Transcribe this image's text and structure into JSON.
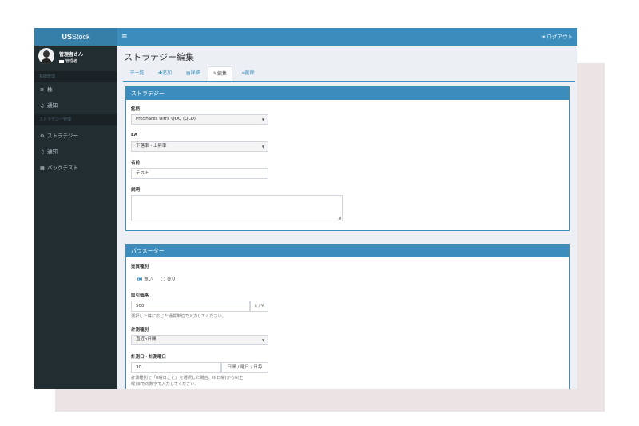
{
  "app": {
    "logo_bold": "US",
    "logo_rest": "Stock",
    "menu_icon": "≡",
    "logout_label": "ログアウト"
  },
  "user": {
    "name": "管理者さん",
    "role": "管理者"
  },
  "sidebar": {
    "section1": "株価管理",
    "section1_items": [
      {
        "label": "株",
        "icon": "database-icon"
      },
      {
        "label": "通知",
        "icon": "bell-icon"
      }
    ],
    "section2": "ストラテジー管理",
    "section2_items": [
      {
        "label": "ストラテジー",
        "icon": "cogs-icon"
      },
      {
        "label": "通知",
        "icon": "bell-icon"
      },
      {
        "label": "バックテスト",
        "icon": "calendar-icon"
      }
    ]
  },
  "page": {
    "title": "ストラテジー編集"
  },
  "tabs": [
    {
      "label": "一覧",
      "icon": "list-icon"
    },
    {
      "label": "追加",
      "icon": "plus-icon"
    },
    {
      "label": "詳細",
      "icon": "table-icon"
    },
    {
      "label": "編集",
      "icon": "edit-icon",
      "active": true
    },
    {
      "label": "削除",
      "icon": "minus-icon"
    }
  ],
  "strategy_box": {
    "title": "ストラテジー",
    "symbol_label": "銘柄",
    "symbol_value": "ProShares Ultra QQQ (QLD)",
    "ea_label": "EA",
    "ea_value": "下落率・上昇率",
    "name_label": "名前",
    "name_value": "テスト",
    "desc_label": "説明",
    "desc_value": ""
  },
  "param_box": {
    "title": "パラメーター",
    "trade_type_label": "売買種別",
    "buy_label": "買い",
    "sell_label": "売り",
    "selected": "buy",
    "price_label": "取引価格",
    "price_value": "500",
    "price_unit": "$ / ¥",
    "price_help": "選択した株に応じた通貨単位で入力してください。",
    "measure_label": "計測種別",
    "measure_value": "直近n日間",
    "measure_day_label": "計測日・計測曜日",
    "measure_day_value": "30",
    "measure_day_unit": "日間 / 曜日 / 日毎",
    "measure_day_help_1": "計測種別で「n曜日ごと」を選択した場合、0(日曜)から6(土",
    "measure_day_help_2": "曜)までの数字で入力してください。"
  },
  "colors": {
    "primary": "#3c8dbc",
    "sidebar": "#222d32",
    "background": "#ecf0f5"
  }
}
